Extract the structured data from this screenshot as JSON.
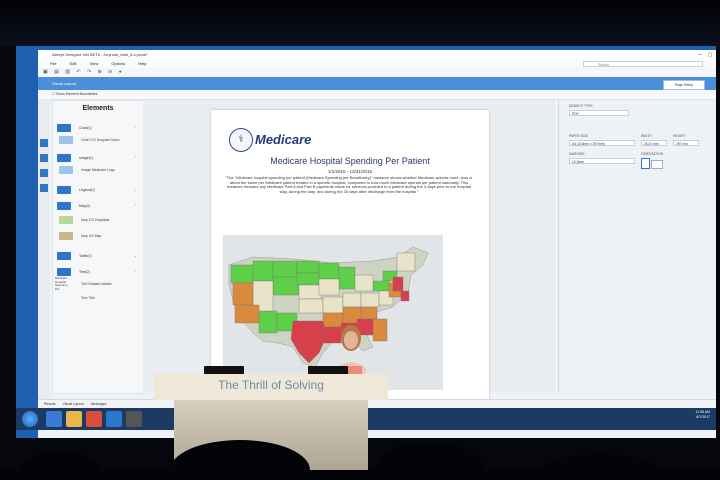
{
  "app": {
    "window_title": "Alteryx Designer x64 BETA - Keynote_blah_8 s.yxmd*",
    "menus": [
      "File",
      "Edit",
      "View",
      "Options",
      "Help"
    ],
    "search_placeholder": "Search",
    "ribbon_label": "Visual Layout",
    "page_setup_button": "Page Setup",
    "show_boundaries": "Show Element Boundaries"
  },
  "elements_panel": {
    "title": "Elements",
    "groups": [
      {
        "name": "Chart(1)",
        "sub": "Chart CO Hospital Score"
      },
      {
        "name": "Image(1)",
        "sub": "Image Medicare Logo"
      },
      {
        "name": "Legend(1)",
        "sub": ""
      },
      {
        "name": "Map(2)",
        "sub": "Map CO Hospitals"
      },
      {
        "name": "Map US Map",
        "sub": ""
      },
      {
        "name": "Table(4)",
        "sub": ""
      },
      {
        "name": "Text(2)",
        "sub": "Text Dataset details"
      },
      {
        "name": "Text Title",
        "sub": ""
      }
    ],
    "side_label": "Medicare Hospital Spending Per"
  },
  "document": {
    "logo_text": "Medicare",
    "title": "Medicare Hospital Spending Per Patient",
    "dates": "1/1/2015 - 12/31/2015",
    "description": "\"The \"Medicare hospital spending per patient (Medicare Spending per Beneficiary)\" measure shows whether Medicare spends more, less or about the same per Medicare patient treated in a specific hospital, compared to how much Medicare spends per patient nationally. This measure includes any Medicare Part A and Part B payments made for services provided to a patient during the 3 days prior to the hospital stay, during the stay, and during the 30 days after discharge from the hospital.\""
  },
  "properties": {
    "density_type_label": "DENSITY TYPE",
    "density_type_value": "PDF",
    "paper_size_label": "PAPER SIZE",
    "paper_size_value": "A4 (210mm x 297mm)",
    "width_label": "WIDTH",
    "width_value": "210.0 mm",
    "height_label": "HEIGHT",
    "height_value": "297 mm",
    "margins_label": "MARGINS",
    "margins_value": "10.0mm",
    "orientation_label": "ORIENTATION"
  },
  "statusbar": {
    "tabs": [
      "Results",
      "Visual Layout",
      "Messages"
    ]
  },
  "taskbar": {
    "time": "11:58 AM",
    "date": "6/7/2017"
  },
  "stage": {
    "podium_text": "The Thrill of Solving"
  },
  "map_colors": {
    "green": "#5fcf4a",
    "light": "#e9e3c9",
    "orange": "#d98a3c",
    "red": "#d6404a"
  }
}
